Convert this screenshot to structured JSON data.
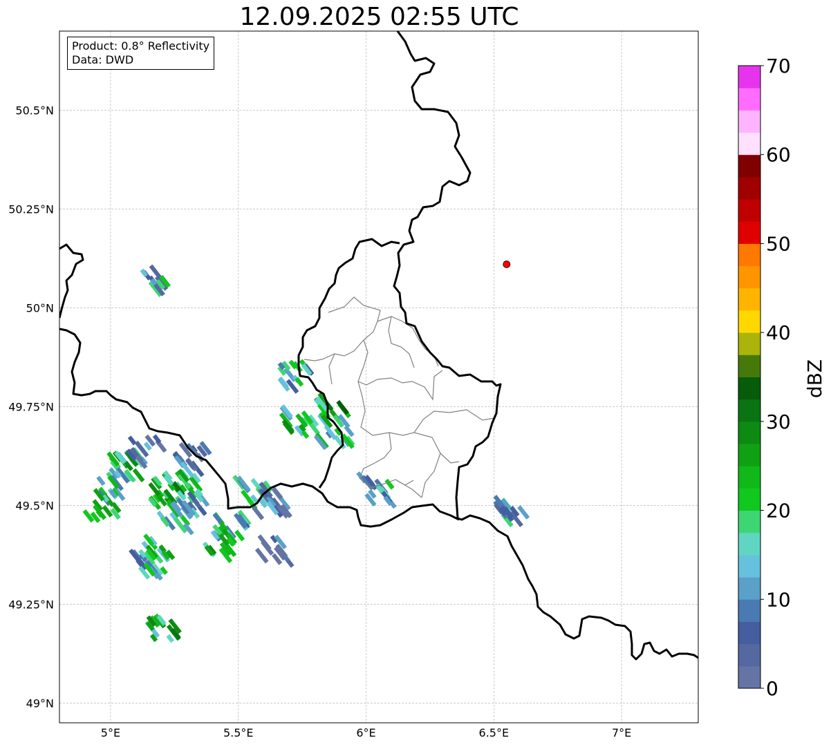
{
  "title": "12.09.2025 02:55 UTC",
  "info": {
    "product_line": "Product: 0.8° Reflectivity",
    "data_line": "Data: DWD"
  },
  "map": {
    "lon_range": [
      4.8,
      7.3
    ],
    "lat_range": [
      48.95,
      50.7
    ],
    "grid": true,
    "lon_ticks": [
      {
        "value": 5.0,
        "label": "5°E"
      },
      {
        "value": 5.5,
        "label": "5.5°E"
      },
      {
        "value": 6.0,
        "label": "6°E"
      },
      {
        "value": 6.5,
        "label": "6.5°E"
      },
      {
        "value": 7.0,
        "label": "7°E"
      }
    ],
    "lat_ticks": [
      {
        "value": 50.5,
        "label": "50.5°N"
      },
      {
        "value": 50.25,
        "label": "50.25°N"
      },
      {
        "value": 50.0,
        "label": "50°N"
      },
      {
        "value": 49.75,
        "label": "49.75°N"
      },
      {
        "value": 49.5,
        "label": "49.5°N"
      },
      {
        "value": 49.25,
        "label": "49.25°N"
      },
      {
        "value": 49.0,
        "label": "49°N"
      }
    ],
    "radar_site": {
      "lon": 6.55,
      "lat": 50.11,
      "color": "#ff0000"
    }
  },
  "colorbar": {
    "label": "dBZ",
    "min": 0,
    "max": 70,
    "ticks": [
      {
        "value": 0,
        "label": "0"
      },
      {
        "value": 10,
        "label": "10"
      },
      {
        "value": 20,
        "label": "20"
      },
      {
        "value": 30,
        "label": "30"
      },
      {
        "value": 40,
        "label": "40"
      },
      {
        "value": 50,
        "label": "50"
      },
      {
        "value": 60,
        "label": "60"
      },
      {
        "value": 70,
        "label": "70"
      }
    ],
    "colors": [
      "#6474a4",
      "#5668a0",
      "#445ea0",
      "#4a7ab2",
      "#5aa0c8",
      "#66c2dc",
      "#60d6c2",
      "#3ed674",
      "#10c81e",
      "#10b81a",
      "#10a014",
      "#0c8a12",
      "#0a7412",
      "#065c0a",
      "#457a0a",
      "#aab40a",
      "#ffd800",
      "#ffb400",
      "#ff9600",
      "#ff7800",
      "#e00000",
      "#c00000",
      "#a00000",
      "#800000",
      "#ffe0ff",
      "#ffb4ff",
      "#ff6cff",
      "#e634ee"
    ]
  },
  "echo_clusters": [
    {
      "lon": 5.06,
      "lat": 49.6,
      "dbz": 22
    },
    {
      "lon": 5.02,
      "lat": 49.55,
      "dbz": 18
    },
    {
      "lon": 4.97,
      "lat": 49.5,
      "dbz": 22
    },
    {
      "lon": 5.14,
      "lat": 49.64,
      "dbz": 10
    },
    {
      "lon": 5.22,
      "lat": 49.53,
      "dbz": 24
    },
    {
      "lon": 5.28,
      "lat": 49.55,
      "dbz": 26
    },
    {
      "lon": 5.33,
      "lat": 49.51,
      "dbz": 14
    },
    {
      "lon": 5.25,
      "lat": 49.47,
      "dbz": 18
    },
    {
      "lon": 5.19,
      "lat": 49.4,
      "dbz": 20
    },
    {
      "lon": 5.15,
      "lat": 49.35,
      "dbz": 16
    },
    {
      "lon": 5.47,
      "lat": 49.44,
      "dbz": 18
    },
    {
      "lon": 5.44,
      "lat": 49.4,
      "dbz": 22
    },
    {
      "lon": 5.2,
      "lat": 49.19,
      "dbz": 24
    },
    {
      "lon": 5.18,
      "lat": 50.07,
      "dbz": 14
    },
    {
      "lon": 5.56,
      "lat": 49.53,
      "dbz": 14
    },
    {
      "lon": 5.63,
      "lat": 49.51,
      "dbz": 8
    },
    {
      "lon": 5.65,
      "lat": 49.39,
      "dbz": 8
    },
    {
      "lon": 5.72,
      "lat": 49.83,
      "dbz": 16
    },
    {
      "lon": 5.74,
      "lat": 49.71,
      "dbz": 22
    },
    {
      "lon": 5.87,
      "lat": 49.74,
      "dbz": 26
    },
    {
      "lon": 5.88,
      "lat": 49.69,
      "dbz": 20
    },
    {
      "lon": 6.04,
      "lat": 49.54,
      "dbz": 16
    },
    {
      "lon": 6.57,
      "lat": 49.48,
      "dbz": 12
    },
    {
      "lon": 5.32,
      "lat": 49.62,
      "dbz": 8
    }
  ]
}
